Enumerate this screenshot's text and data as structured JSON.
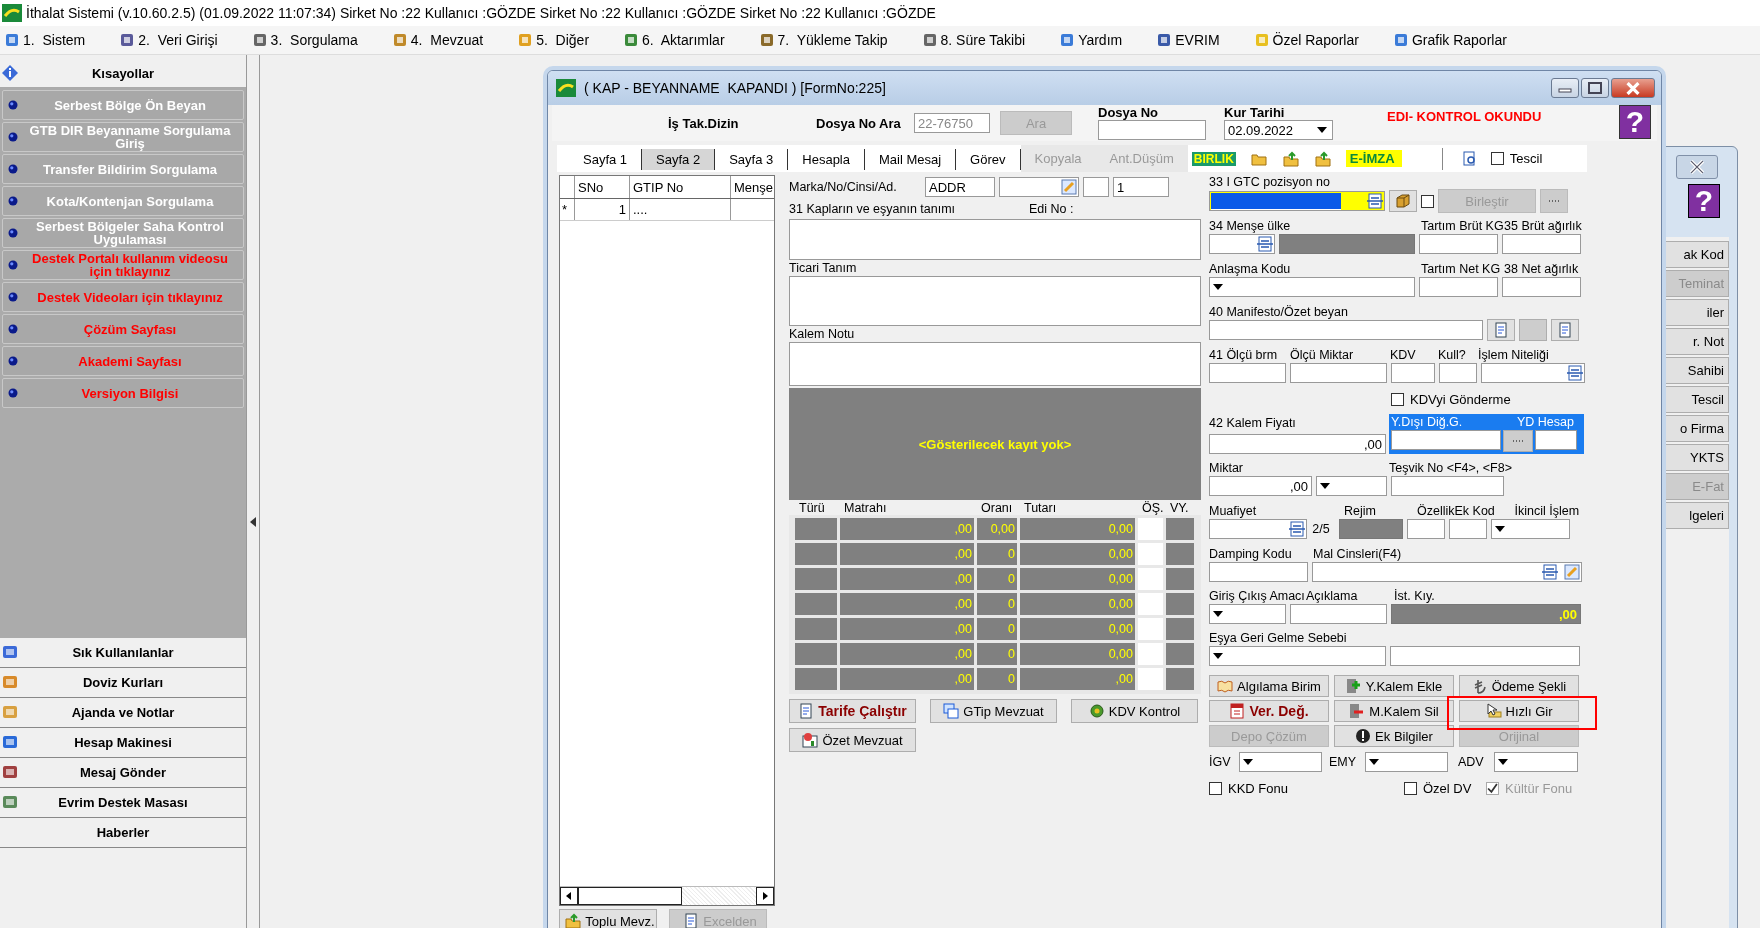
{
  "app": {
    "title": "İthalat Sistemi (v.10.60.2.5) (01.09.2022 11:07:34) Sirket No :22 Kullanıcı :GÖZDE Sirket No :22 Kullanıcı :GÖZDE Sirket No :22 Kullanıcı :GÖZDE"
  },
  "menu": [
    {
      "label": "1.  Sistem"
    },
    {
      "label": "2.  Veri Girişi"
    },
    {
      "label": "3.  Sorgulama"
    },
    {
      "label": "4.  Mevzuat"
    },
    {
      "label": "5.  Diğer"
    },
    {
      "label": "6.  Aktarımlar"
    },
    {
      "label": "7.  Yükleme Takip"
    },
    {
      "label": "8. Süre Takibi"
    },
    {
      "label": "Yardım"
    },
    {
      "label": "EVRIM"
    },
    {
      "label": "Özel Raporlar"
    },
    {
      "label": "Grafik Raporlar"
    }
  ],
  "sidebar": {
    "title": "Kısayollar",
    "shortcuts": [
      {
        "label": "Serbest Bölge Ön Beyan",
        "color": "#ffffff"
      },
      {
        "label": "GTB DIR Beyanname Sorgulama Giriş",
        "color": "#ffffff"
      },
      {
        "label": "Transfer Bildirim Sorgulama",
        "color": "#ffffff"
      },
      {
        "label": "Kota/Kontenjan Sorgulama",
        "color": "#ffffff"
      },
      {
        "label": "Serbest Bölgeler Saha Kontrol Uygulaması",
        "color": "#ffffff"
      },
      {
        "label": "Destek Portalı kullanım videosu için tıklayınız",
        "color": "#ff0000"
      },
      {
        "label": "Destek Videoları için tıklayınız",
        "color": "#ff0000"
      },
      {
        "label": "Çözüm Sayfası",
        "color": "#ff0000"
      },
      {
        "label": "Akademi Sayfası",
        "color": "#ff0000"
      },
      {
        "label": "Versiyon Bilgisi",
        "color": "#ff0000"
      }
    ],
    "panels": [
      {
        "label": "Sık Kullanılanlar"
      },
      {
        "label": "Doviz Kurları"
      },
      {
        "label": "Ajanda ve Notlar"
      },
      {
        "label": "Hesap Makinesi"
      },
      {
        "label": "Mesaj Gönder"
      },
      {
        "label": "Evrim Destek Masası"
      },
      {
        "label": "Haberler"
      }
    ]
  },
  "background_window": {
    "buttons": [
      {
        "label": "ak Kod",
        "disabled": false
      },
      {
        "label": "Teminat",
        "disabled": true
      },
      {
        "label": "iler",
        "disabled": false
      },
      {
        "label": "r. Not",
        "disabled": false
      },
      {
        "label": "Sahibi",
        "disabled": false
      },
      {
        "label": "Tescil",
        "disabled": false
      },
      {
        "label": "o Firma",
        "disabled": false
      },
      {
        "label": "YKTS",
        "disabled": false
      },
      {
        "label": "E-Fat",
        "disabled": true
      },
      {
        "label": "lgeleri",
        "disabled": false
      }
    ]
  },
  "dialog": {
    "title": "( KAP - BEYANNAME  KAPANDI ) [FormNo:225]",
    "help": "?",
    "header": {
      "dizin": "İş Tak.Dizin",
      "search_label": "Dosya No Ara",
      "search_value": "22-76750",
      "search_button": "Ara",
      "file_label": "Dosya No",
      "rate_label": "Kur Tarihi",
      "rate_date": "02.09.2022",
      "status": "EDI- KONTROL OKUNDU"
    },
    "tabs": [
      {
        "label": "Sayfa 1",
        "selected": false,
        "disabled": false
      },
      {
        "label": "Sayfa 2",
        "selected": true,
        "disabled": false
      },
      {
        "label": "Sayfa 3",
        "selected": false,
        "disabled": false
      },
      {
        "label": "Hesapla",
        "selected": false,
        "disabled": false
      },
      {
        "label": "Mail Mesaj",
        "selected": false,
        "disabled": false
      },
      {
        "label": "Görev",
        "selected": false,
        "disabled": false
      },
      {
        "label": "Kopyala",
        "selected": false,
        "disabled": true
      },
      {
        "label": "Ant.Düşüm",
        "selected": false,
        "disabled": true
      }
    ],
    "toolbar": {
      "birlik": "BIRLIK",
      "eimza": "E-İMZA",
      "tescil": {
        "label": "Tescil",
        "checked": false
      }
    },
    "grid": {
      "columns": [
        "SNo",
        "GTIP No",
        "Menşe"
      ],
      "rows": [
        {
          "marker": "*",
          "sno": "1",
          "gtip": "...."
        }
      ],
      "buttons": [
        {
          "label": "Toplu Mevz.",
          "disabled": false
        },
        {
          "label": "Excelden",
          "disabled": true
        }
      ]
    },
    "item": {
      "marka_label": "Marka/No/Cinsi/Ad.",
      "marka_value": "ADDR",
      "count_value": "1",
      "desc_label": "31 Kapların ve eşyanın tanımı",
      "edi_label": "Edi No :",
      "trade_label": "Ticari Tanım",
      "note_label": "Kalem Notu",
      "empty_text": "<Gösterilecek kayıt yok>"
    },
    "taxes": {
      "columns": [
        "Türü",
        "Matrahı",
        "Oranı",
        "Tutarı",
        "ÖŞ.",
        "VY."
      ],
      "rows": [
        {
          "matrah": ",00",
          "oran": "0,00",
          "tutar": "0,00"
        },
        {
          "matrah": ",00",
          "oran": "0",
          "tutar": "0,00"
        },
        {
          "matrah": ",00",
          "oran": "0",
          "tutar": "0,00"
        },
        {
          "matrah": ",00",
          "oran": "0",
          "tutar": "0,00"
        },
        {
          "matrah": ",00",
          "oran": "0",
          "tutar": "0,00"
        },
        {
          "matrah": ",00",
          "oran": "0",
          "tutar": "0,00"
        },
        {
          "matrah": ",00",
          "oran": "0",
          "tutar": ",00"
        }
      ]
    },
    "mid_buttons": [
      {
        "label": "Tarife Çalıştır",
        "strong": true
      },
      {
        "label": "GTip Mevzuat",
        "strong": false
      },
      {
        "label": "KDV Kontrol",
        "strong": false
      },
      {
        "label": "Özet Mevzuat",
        "strong": false
      }
    ],
    "fields": {
      "gtc_label": "33 I GTC pozisyon no",
      "gtc_checked": false,
      "merge_button": "Birleştir",
      "origin_label": "34 Menşe ülke",
      "tare_gross_label": "Tartım Brüt KG",
      "gross_label": "35 Brüt ağırlık",
      "agreement_label": "Anlaşma Kodu",
      "tare_net_label": "Tartım Net KG",
      "net_label": "38 Net ağırlık",
      "manifest_label": "40 Manifesto/Özet beyan",
      "unit_label": "41 Ölçü brm",
      "unit_qty_label": "Ölçü Miktar",
      "kdv_label": "KDV",
      "used_label": "Kull?",
      "process_label": "İşlem Niteliği",
      "kdv_send": {
        "label": "KDVyi Gönderme",
        "checked": false
      },
      "price_label": "42 Kalem Fiyatı",
      "price_value": ",00",
      "foreign_label": "Y.Dışı Diğ.G.",
      "yd_label": "YD Hesap",
      "qty_label": "Miktar",
      "qty_value": ",00",
      "incentive_label": "Teşvik No <F4>, <F8>",
      "exempt_label": "Muafiyet",
      "exempt_count": "2/5",
      "regime_label": "Rejim",
      "feature_label": "Özellik",
      "extra_label": "Ek Kod",
      "secondary_label": "İkincil İşlem",
      "dumping_label": "Damping Kodu",
      "goods_label": "Mal Cinsleri(F4)",
      "purpose_label": "Giriş Çıkış Amacı",
      "explain_label": "Açıklama",
      "limit_label": "İst. Kıy.",
      "limit_value": ",00",
      "return_label": "Eşya Geri Gelme Sebebi",
      "igv_label": "İGV",
      "emy_label": "EMY",
      "adv_label": "ADV"
    },
    "right_buttons": [
      {
        "label": "Algılama Birim",
        "disabled": false,
        "strong": false,
        "highlighted": false
      },
      {
        "label": "Y.Kalem Ekle",
        "disabled": false,
        "strong": false,
        "highlighted": false
      },
      {
        "label": "Ödeme Şekli",
        "disabled": false,
        "strong": false,
        "highlighted": false
      },
      {
        "label": "Ver. Değ.",
        "disabled": false,
        "strong": true,
        "highlighted": false
      },
      {
        "label": "M.Kalem Sil",
        "disabled": false,
        "strong": false,
        "highlighted": false
      },
      {
        "label": "Hızlı Gir",
        "disabled": false,
        "strong": false,
        "highlighted": true
      },
      {
        "label": "Depo Çözüm",
        "disabled": true,
        "strong": false,
        "highlighted": false
      },
      {
        "label": "Ek Bilgiler",
        "disabled": false,
        "strong": false,
        "highlighted": false
      },
      {
        "label": "Orijinal",
        "disabled": true,
        "strong": false,
        "highlighted": false
      }
    ],
    "funds": [
      {
        "label": "KKD Fonu",
        "checked": false,
        "disabled": false
      },
      {
        "label": "Özel DV",
        "checked": false,
        "disabled": false
      },
      {
        "label": "Kültür Fonu",
        "checked": true,
        "disabled": true
      }
    ]
  }
}
